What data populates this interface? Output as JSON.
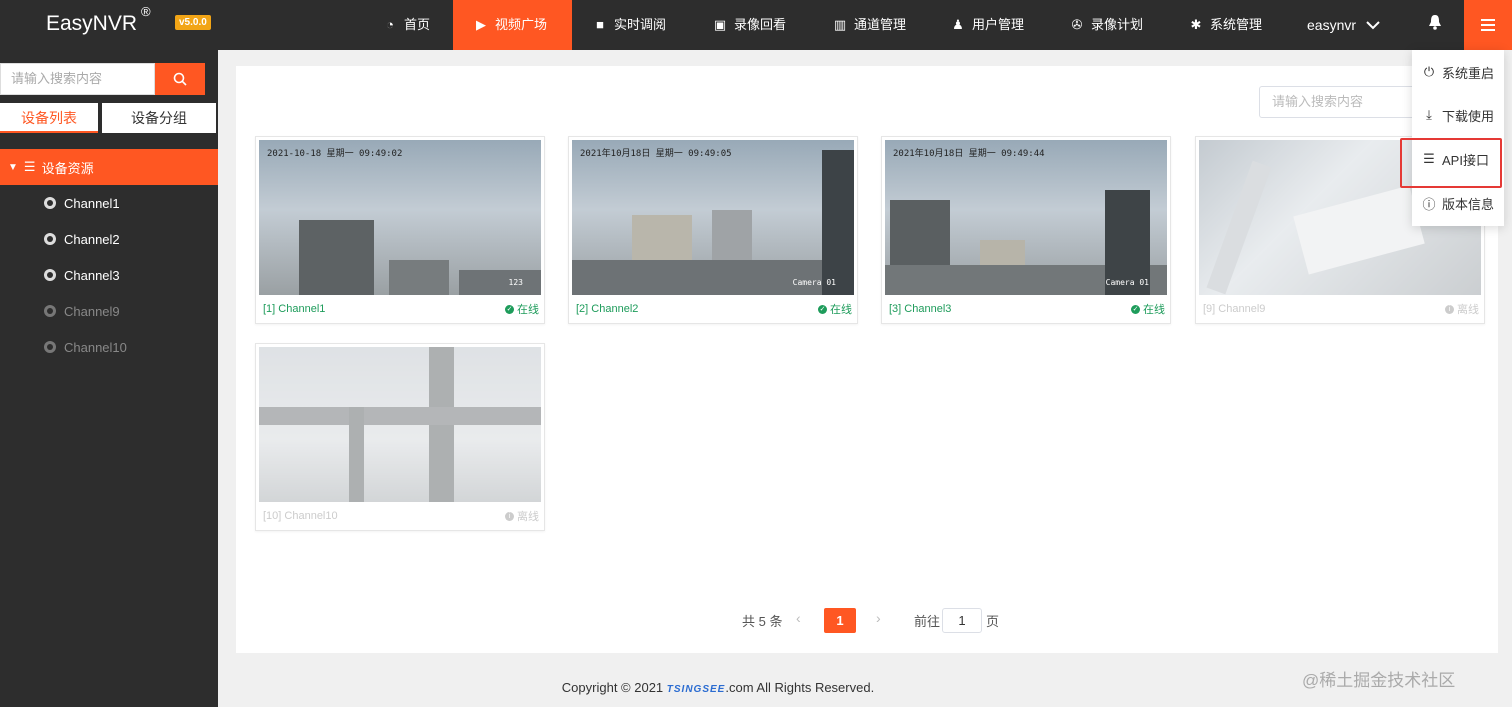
{
  "app": {
    "title": "EasyNVR",
    "registered_mark": "®",
    "version": "v5.0.0"
  },
  "nav": [
    {
      "label": "首页",
      "icon": "dashboard-icon"
    },
    {
      "label": "视频广场",
      "icon": "play-circle-icon",
      "active": true
    },
    {
      "label": "实时调阅",
      "icon": "video-camera-icon"
    },
    {
      "label": "录像回看",
      "icon": "playback-icon"
    },
    {
      "label": "通道管理",
      "icon": "columns-icon"
    },
    {
      "label": "用户管理",
      "icon": "user-icon"
    },
    {
      "label": "录像计划",
      "icon": "film-reel-icon"
    },
    {
      "label": "系统管理",
      "icon": "gear-icon"
    }
  ],
  "user": {
    "name": "easynvr"
  },
  "sidebar": {
    "search_placeholder": "请输入搜索内容",
    "tabs": [
      "设备列表",
      "设备分组"
    ],
    "root": "设备资源",
    "channels": [
      {
        "label": "Channel1",
        "online": true
      },
      {
        "label": "Channel2",
        "online": true
      },
      {
        "label": "Channel3",
        "online": true
      },
      {
        "label": "Channel9",
        "online": false
      },
      {
        "label": "Channel10",
        "online": false
      }
    ]
  },
  "main": {
    "search_placeholder": "请输入搜索内容",
    "cards": [
      {
        "label": "[1] Channel1",
        "status": "在线",
        "online": true,
        "stamp": "2021-10-18  星期一  09:49:02",
        "cam": "123"
      },
      {
        "label": "[2] Channel2",
        "status": "在线",
        "online": true,
        "stamp": "2021年10月18日  星期一  09:49:05",
        "cam": "Camera 01"
      },
      {
        "label": "[3] Channel3",
        "status": "在线",
        "online": true,
        "stamp": "2021年10月18日  星期一  09:49:44",
        "cam": "Camera 01"
      },
      {
        "label": "[9] Channel9",
        "status": "离线",
        "online": false,
        "stamp": "",
        "cam": ""
      },
      {
        "label": "[10] Channel10",
        "status": "离线",
        "online": false,
        "stamp": "",
        "cam": ""
      }
    ]
  },
  "pagination": {
    "total": "共 5 条",
    "current": "1",
    "goto_prefix": "前往",
    "goto_value": "1",
    "goto_suffix": "页"
  },
  "footer": {
    "prefix": "Copyright © 2021",
    "brand": "TSINGSEE",
    "suffix": ".com All Rights Reserved."
  },
  "dropdown": [
    {
      "label": "系统重启",
      "icon": "power-icon"
    },
    {
      "label": "下载使用",
      "icon": "download-icon"
    },
    {
      "label": "API接口",
      "icon": "list-icon"
    },
    {
      "label": "版本信息",
      "icon": "info-icon"
    }
  ],
  "watermark": "@稀土掘金技术社区",
  "colors": {
    "accent": "#ff5722",
    "topbar": "#2d2d2d",
    "online": "#1e9c5b",
    "version_badge": "#f2a516"
  }
}
